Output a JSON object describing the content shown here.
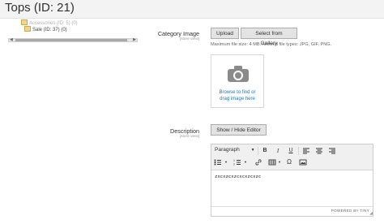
{
  "page": {
    "title": "Tops (ID: 21)"
  },
  "category_tree": {
    "faded_label": "Accessories (ID: 5) (0)",
    "item_label": "Sale (ID: 37) (0)"
  },
  "category_image": {
    "label": "Category Image",
    "scope": "[store view]",
    "upload_button": "Upload",
    "gallery_button": "Select from Gallery",
    "help_text": "Maximum file size: 4 MB. Allowed file types: JPG, GIF, PNG.",
    "placeholder_line1": "Browse to find or",
    "placeholder_line2": "drag image here",
    "icon": "camera-icon"
  },
  "description": {
    "label": "Description",
    "scope": "[store view]",
    "toggle_button": "Show / Hide Editor",
    "editor": {
      "format_select": "Paragraph",
      "toolbar_icons": [
        "bold-icon",
        "italic-icon",
        "underline-icon",
        "align-left-icon",
        "align-center-icon",
        "align-right-icon",
        "bullet-list-icon",
        "numbered-list-icon",
        "link-icon",
        "table-icon",
        "special-char-icon",
        "image-icon"
      ],
      "bold": "B",
      "italic": "I",
      "underline": "U",
      "omega": "Ω",
      "content": "zxcxzcxzcxcxzcxzc",
      "powered_by": "POWERED BY TINY"
    }
  },
  "colors": {
    "link": "#1979c3",
    "button_bg": "#e3e3e3",
    "toolbar_bg": "#f0f0f0"
  }
}
